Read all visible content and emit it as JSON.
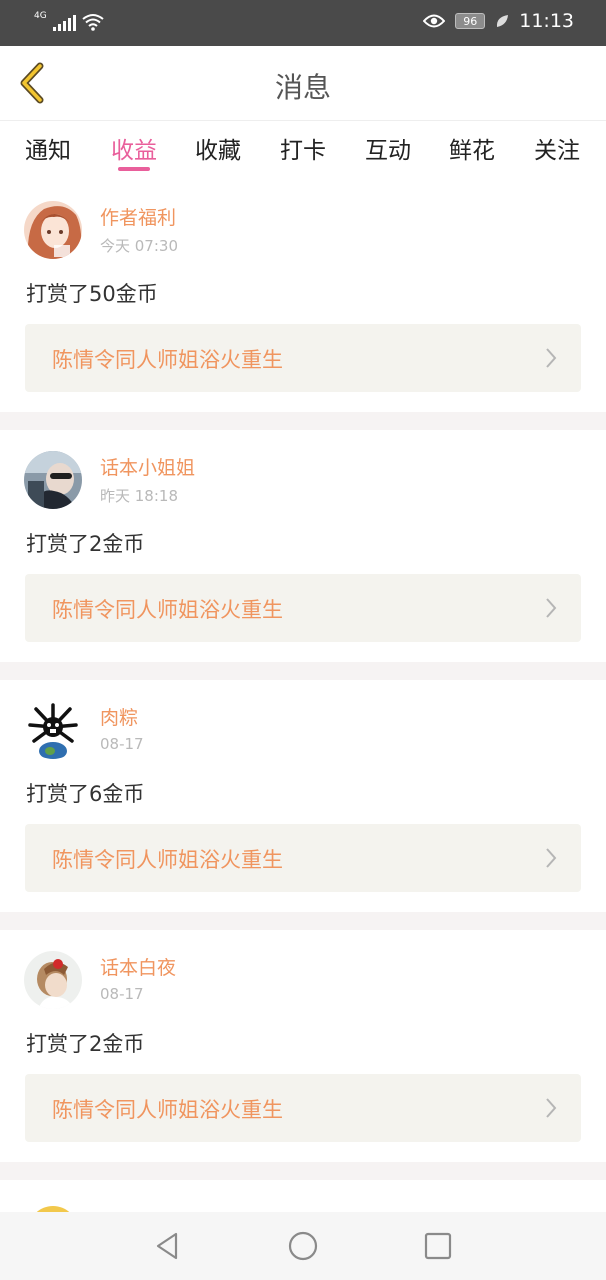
{
  "status_bar": {
    "network": "4G",
    "battery": "96",
    "time": "11:13",
    "icons": [
      "signal-icon",
      "wifi-icon",
      "eye-icon",
      "battery-icon",
      "leaf-icon"
    ]
  },
  "header": {
    "title": "消息",
    "back_icon": "chevron-left-icon",
    "accent_color": "#e95f9b"
  },
  "tabs": [
    {
      "label": "通知",
      "active": false
    },
    {
      "label": "收益",
      "active": true
    },
    {
      "label": "收藏",
      "active": false
    },
    {
      "label": "打卡",
      "active": false
    },
    {
      "label": "互动",
      "active": false
    },
    {
      "label": "鲜花",
      "active": false
    },
    {
      "label": "关注",
      "active": false
    }
  ],
  "messages": [
    {
      "user": "作者福利",
      "time": "今天 07:30",
      "text": "打赏了50金币",
      "book": "陈情令同人师姐浴火重生"
    },
    {
      "user": "话本小姐姐",
      "time": "昨天 18:18",
      "text": "打赏了2金币",
      "book": "陈情令同人师姐浴火重生"
    },
    {
      "user": "肉粽",
      "time": "08-17",
      "text": "打赏了6金币",
      "book": "陈情令同人师姐浴火重生"
    },
    {
      "user": "话本白夜",
      "time": "08-17",
      "text": "打赏了2金币",
      "book": "陈情令同人师姐浴火重生"
    }
  ],
  "colors": {
    "username": "#f0955f",
    "book_title": "#f0955f",
    "link_background": "#f4f3ee",
    "time": "#b9b9b9"
  },
  "nav_bar": {
    "icons": [
      "back-triangle-icon",
      "home-circle-icon",
      "recents-square-icon"
    ]
  }
}
